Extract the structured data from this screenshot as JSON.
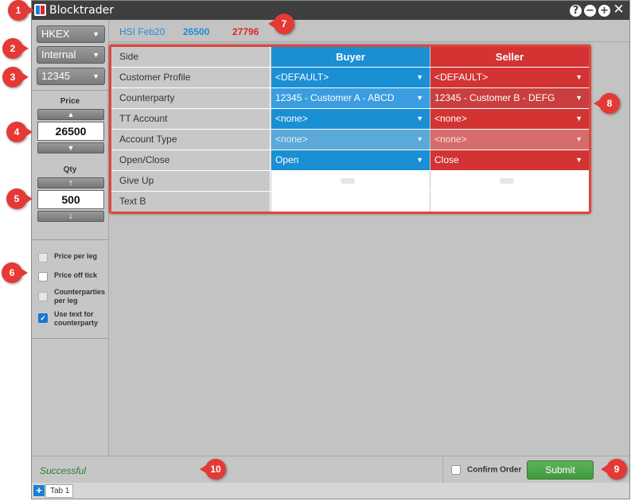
{
  "window": {
    "title": "Blocktrader"
  },
  "left_panel": {
    "exchange": "HKEX",
    "account_type": "Internal",
    "account": "12345",
    "price_label": "Price",
    "price_value": "26500",
    "qty_label": "Qty",
    "qty_value": "500",
    "options": [
      {
        "label": "Price per leg",
        "checked": false
      },
      {
        "label": "Price off tick",
        "checked": false
      },
      {
        "label": "Counterparties per leg",
        "checked": false
      },
      {
        "label": "Use text for counterparty",
        "checked": true
      }
    ]
  },
  "info_bar": {
    "instrument": "HSI Feb20",
    "bid": "26500",
    "ask": "27796"
  },
  "grid": {
    "side": {
      "label": "Side",
      "buyer": "Buyer",
      "seller": "Seller"
    },
    "rows": [
      {
        "label": "Customer Profile",
        "buyer": "<DEFAULT>",
        "seller": "<DEFAULT>"
      },
      {
        "label": "Counterparty",
        "buyer": "12345 - Customer A - ABCD",
        "seller": "12345 - Customer B - DEFG"
      },
      {
        "label": "TT Account",
        "buyer": "<none>",
        "seller": "<none>"
      },
      {
        "label": "Account Type",
        "buyer": "<none>",
        "seller": "<none>"
      },
      {
        "label": "Open/Close",
        "buyer": "Open",
        "seller": "Close"
      },
      {
        "label": "Give Up",
        "buyer": "",
        "seller": ""
      },
      {
        "label": "Text B",
        "buyer": "",
        "seller": ""
      }
    ]
  },
  "status": {
    "message": "Successful",
    "confirm_label": "Confirm Order",
    "submit_label": "Submit"
  },
  "tabs": {
    "add": "+",
    "tab1": "Tab 1"
  },
  "callouts": [
    "1",
    "2",
    "3",
    "4",
    "5",
    "6",
    "7",
    "8",
    "9",
    "10"
  ],
  "colors": {
    "buyer_blue": "#1b8fd4",
    "seller_red": "#d33333",
    "bid_blue": "#1b8fd4",
    "ask_red": "#e0262b",
    "success_green": "#2e7d32",
    "submit_green": "#4ca848"
  }
}
